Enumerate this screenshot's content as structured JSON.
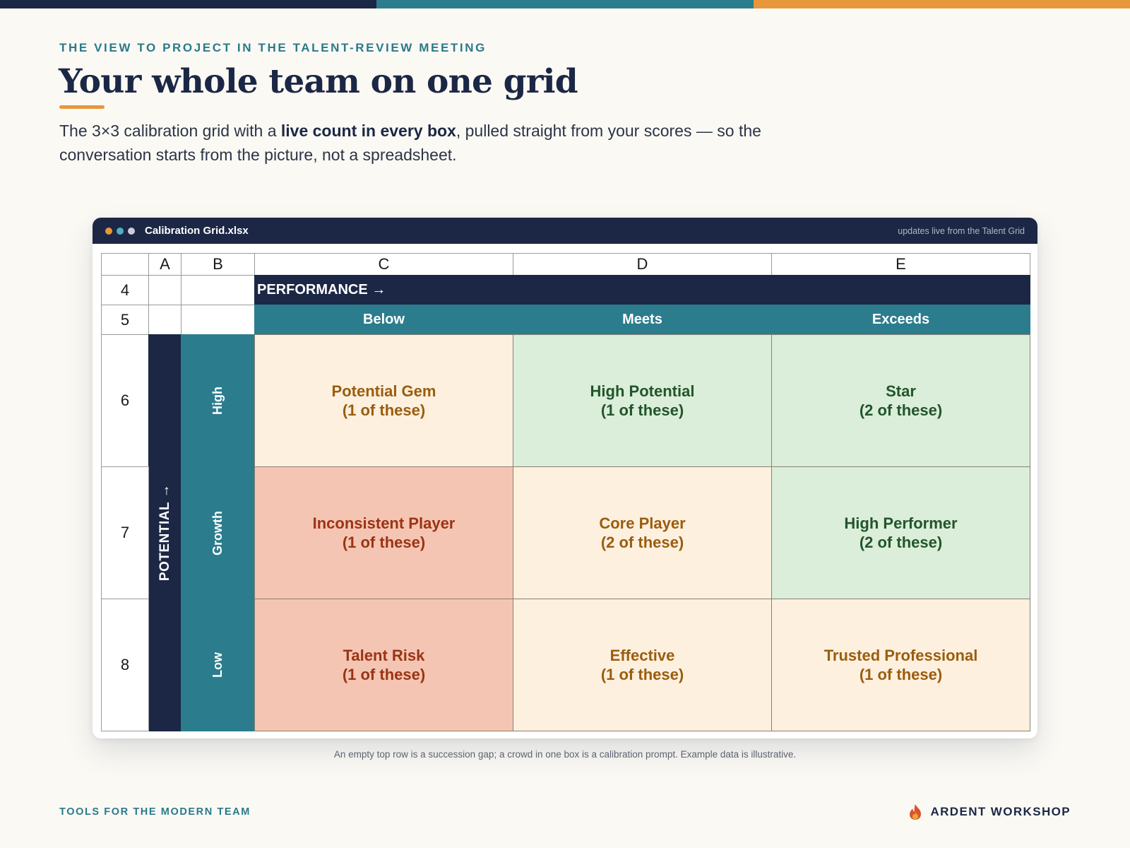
{
  "colors": {
    "navy": "#1b2745",
    "teal": "#2b7d8e",
    "orange": "#e8963a",
    "cream_cell": "#fdf0df",
    "green_cell": "#dbeed9",
    "salmon_cell": "#f5c5b3",
    "amber_text": "#9a5d0e",
    "green_text": "#22552c",
    "red_text": "#9a3414"
  },
  "header": {
    "eyebrow": "THE VIEW TO PROJECT IN THE TALENT-REVIEW MEETING",
    "title": "Your whole team on one grid",
    "sub_pre": "The 3×3 calibration grid with a ",
    "sub_bold": "live count in every box",
    "sub_post": ", pulled straight from your scores — so the conversation starts from the picture, not a spreadsheet."
  },
  "window": {
    "filename": "Calibration Grid.xlsx",
    "live_note": "updates live from the Talent Grid"
  },
  "sheet": {
    "column_headers": [
      "A",
      "B",
      "C",
      "D",
      "E"
    ],
    "row_numbers": [
      "4",
      "5",
      "6",
      "7",
      "8"
    ],
    "performance_label": "PERFORMANCE →",
    "performance_levels": [
      "Below",
      "Meets",
      "Exceeds"
    ],
    "potential_label": "POTENTIAL →",
    "potential_levels": [
      "High",
      "Growth",
      "Low"
    ],
    "boxes": [
      [
        {
          "name": "Potential Gem",
          "count": "(1 of these)"
        },
        {
          "name": "High Potential",
          "count": "(1 of these)"
        },
        {
          "name": "Star",
          "count": "(2 of these)"
        }
      ],
      [
        {
          "name": "Inconsistent Player",
          "count": "(1 of these)"
        },
        {
          "name": "Core Player",
          "count": "(2 of these)"
        },
        {
          "name": "High Performer",
          "count": "(2 of these)"
        }
      ],
      [
        {
          "name": "Talent Risk",
          "count": "(1 of these)"
        },
        {
          "name": "Effective",
          "count": "(1 of these)"
        },
        {
          "name": "Trusted Professional",
          "count": "(1 of these)"
        }
      ]
    ]
  },
  "caption": "An empty top row is a succession gap; a crowd in one box is a calibration prompt. Example data is illustrative.",
  "footer": {
    "tagline": "TOOLS FOR THE MODERN TEAM",
    "brand": "ARDENT WORKSHOP",
    "brand_icon": "flame-icon"
  }
}
